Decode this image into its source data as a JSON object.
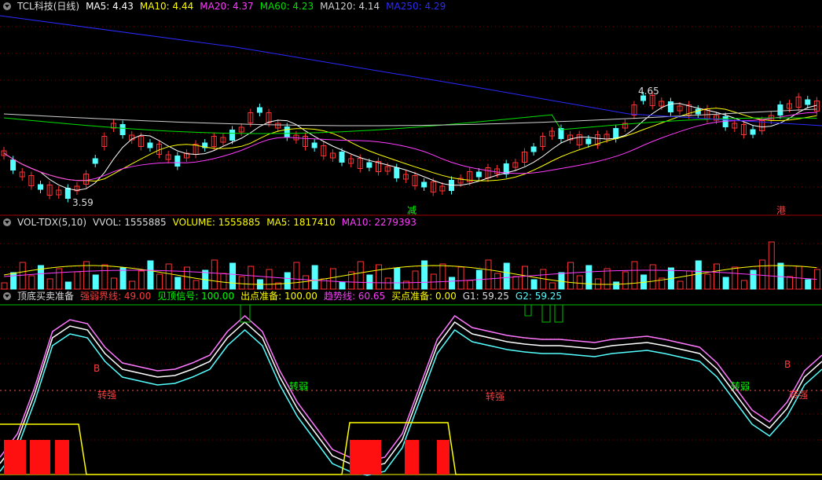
{
  "colors": {
    "bg": "#000000",
    "up": "#ff3232",
    "down": "#54ffff",
    "ma5": "#ffffff",
    "ma10": "#ffff00",
    "ma20": "#ff3cff",
    "ma60": "#00e000",
    "ma120": "#cfcfcf",
    "ma250": "#2a2aff",
    "grid": "#800000"
  },
  "main_header": {
    "title": "TCL科技(日线)",
    "ma5": "MA5: 4.43",
    "ma10": "MA10: 4.44",
    "ma20": "MA20: 4.37",
    "ma60": "MA60: 4.23",
    "ma120": "MA120: 4.14",
    "ma250": "MA250: 4.29"
  },
  "main_annotations": {
    "high_label": "4.65",
    "low_label": "3.59",
    "mark_jian": "减",
    "mark_gang": "港"
  },
  "vol_header": {
    "title": "VOL-TDX(5,10)",
    "vvol": "VVOL: 1555885",
    "volume": "VOLUME: 1555885",
    "ma5": "MA5: 1817410",
    "ma10": "MA10: 2279393"
  },
  "ind_header": {
    "title": "顶底买卖准备",
    "qiangruo": "强弱界线: 49.00",
    "jianding": "见顶信号: 100.00",
    "chudian": "出点准备: 100.00",
    "qushi": "趋势线: 60.65",
    "maidian": "买点准备: 0.00",
    "g1": "G1: 59.25",
    "g2": "G2: 59.25"
  },
  "ind_annotations": {
    "zhuanqiang_1": "转强",
    "zhuanruo_1": "转弱",
    "zhuanqiang_2": "转强",
    "zhuanruo_2": "转弱",
    "zhuanqiang_3": "转强",
    "b1": "B",
    "b2": "B"
  }
}
